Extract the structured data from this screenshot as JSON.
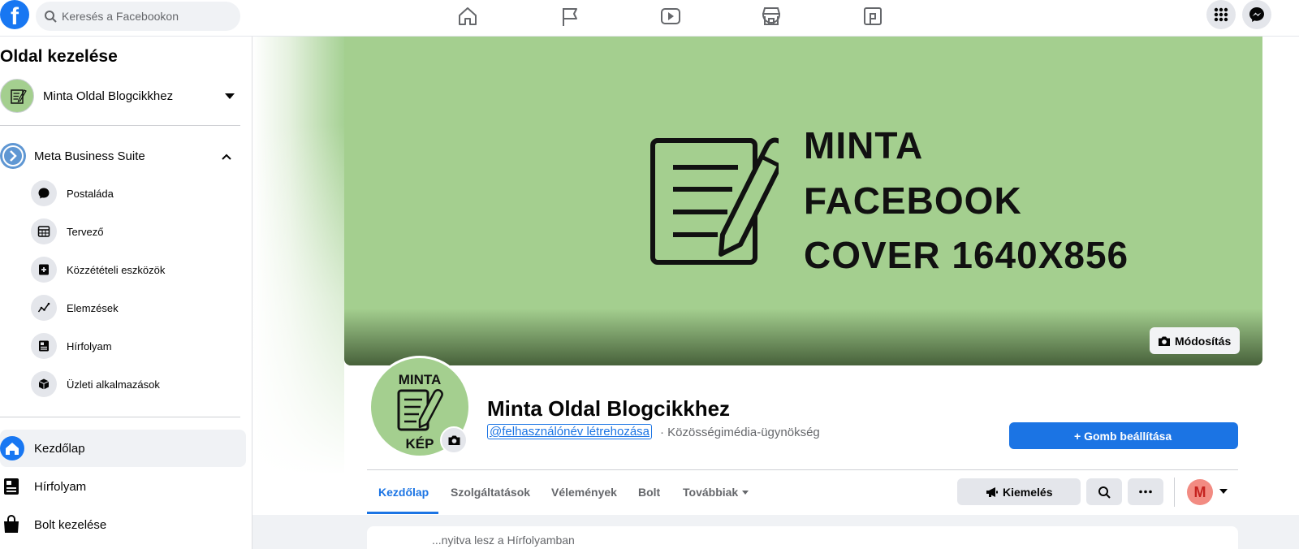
{
  "topbar": {
    "logo_letter": "f",
    "search_placeholder": "Keresés a Facebookon",
    "nav_icons": [
      "home-icon",
      "flag-icon",
      "watch-icon",
      "marketplace-icon",
      "gaming-icon"
    ],
    "right_icons": [
      "menu-grid-icon",
      "messenger-icon"
    ]
  },
  "sidebar": {
    "title": "Oldal kezelése",
    "page_name": "Minta Oldal Blogcikkhez",
    "mbs_label": "Meta Business Suite",
    "sub_items": [
      {
        "label": "Postaláda",
        "icon": "chat-bubble-icon"
      },
      {
        "label": "Tervező",
        "icon": "calendar-icon"
      },
      {
        "label": "Közzétételi eszközök",
        "icon": "publishing-tools-icon"
      },
      {
        "label": "Elemzések",
        "icon": "insights-icon"
      },
      {
        "label": "Hírfolyam",
        "icon": "news-feed-icon"
      },
      {
        "label": "Üzleti alkalmazások",
        "icon": "business-apps-icon"
      }
    ],
    "main_items": [
      {
        "label": "Kezdőlap",
        "icon": "home-icon",
        "active": true
      },
      {
        "label": "Hírfolyam",
        "icon": "news-feed-icon",
        "active": false
      },
      {
        "label": "Bolt kezelése",
        "icon": "shopping-bag-icon",
        "active": false
      }
    ]
  },
  "cover": {
    "lines": [
      "MINTA",
      "FACEBOOK",
      "COVER 1640X856"
    ],
    "edit_label": "Módosítás",
    "color": "#a4cf8f"
  },
  "profile": {
    "pic_top": "MINTA",
    "pic_bottom": "KÉP",
    "title": "Minta Oldal Blogcikkhez",
    "username_link": "@felhasználónév létrehozása",
    "category": "· Közösségimédia-ügynökség",
    "setup_button": "+ Gomb beállítása"
  },
  "tabs": {
    "items": [
      "Kezdőlap",
      "Szolgáltatások",
      "Vélemények",
      "Bolt",
      "Továbbiak"
    ],
    "active_index": 0
  },
  "actions": {
    "promote_label": "Kiemelés",
    "avatar_letter": "M"
  },
  "bottom": {
    "text": "...nyitva lesz a Hírfolyamban"
  },
  "colors": {
    "accent": "#1b74e4",
    "facebook_blue": "#1877f2"
  }
}
